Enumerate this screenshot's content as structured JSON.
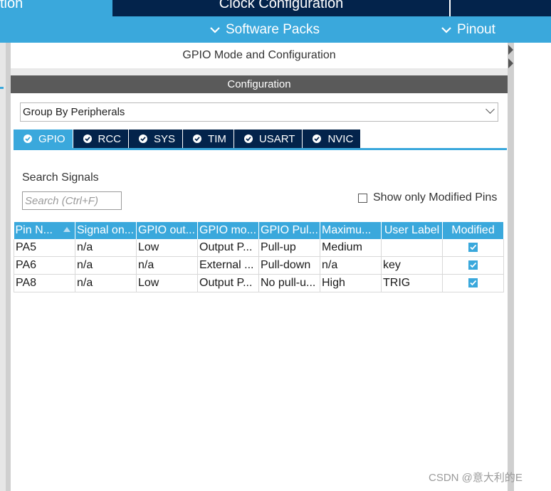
{
  "topbar": {
    "left_tab_partial": "tion",
    "center_title": "Clock Configuration"
  },
  "subbar": {
    "software_packs": "Software Packs",
    "pinout": "Pinout"
  },
  "panel": {
    "mode_title": "GPIO Mode and Configuration",
    "config_header": "Configuration"
  },
  "group_select": {
    "selected": "Group By Peripherals"
  },
  "tabs": [
    {
      "label": "GPIO",
      "active": true
    },
    {
      "label": "RCC",
      "active": false
    },
    {
      "label": "SYS",
      "active": false
    },
    {
      "label": "TIM",
      "active": false
    },
    {
      "label": "USART",
      "active": false
    },
    {
      "label": "NVIC",
      "active": false
    }
  ],
  "search": {
    "label": "Search Signals",
    "placeholder": "Search (Ctrl+F)"
  },
  "show_modified": {
    "label": "Show only Modified Pins",
    "checked": false
  },
  "table": {
    "headers": [
      "Pin N...",
      "Signal on...",
      "GPIO out...",
      "GPIO mo...",
      "GPIO Pul...",
      "Maximu...",
      "User Label",
      "Modified"
    ],
    "rows": [
      [
        "PA5",
        "n/a",
        "Low",
        "Output P...",
        "Pull-up",
        "Medium",
        "",
        true
      ],
      [
        "PA6",
        "n/a",
        "n/a",
        "External ...",
        "Pull-down",
        "n/a",
        "key",
        true
      ],
      [
        "PA8",
        "n/a",
        "Low",
        "Output P...",
        "No pull-u...",
        "High",
        "TRIG",
        true
      ]
    ]
  },
  "watermark": "CSDN @意大利的E",
  "colors": {
    "accent_blue": "#3aa8dc",
    "navy": "#03234b",
    "header_gray": "#5a5a5a"
  }
}
